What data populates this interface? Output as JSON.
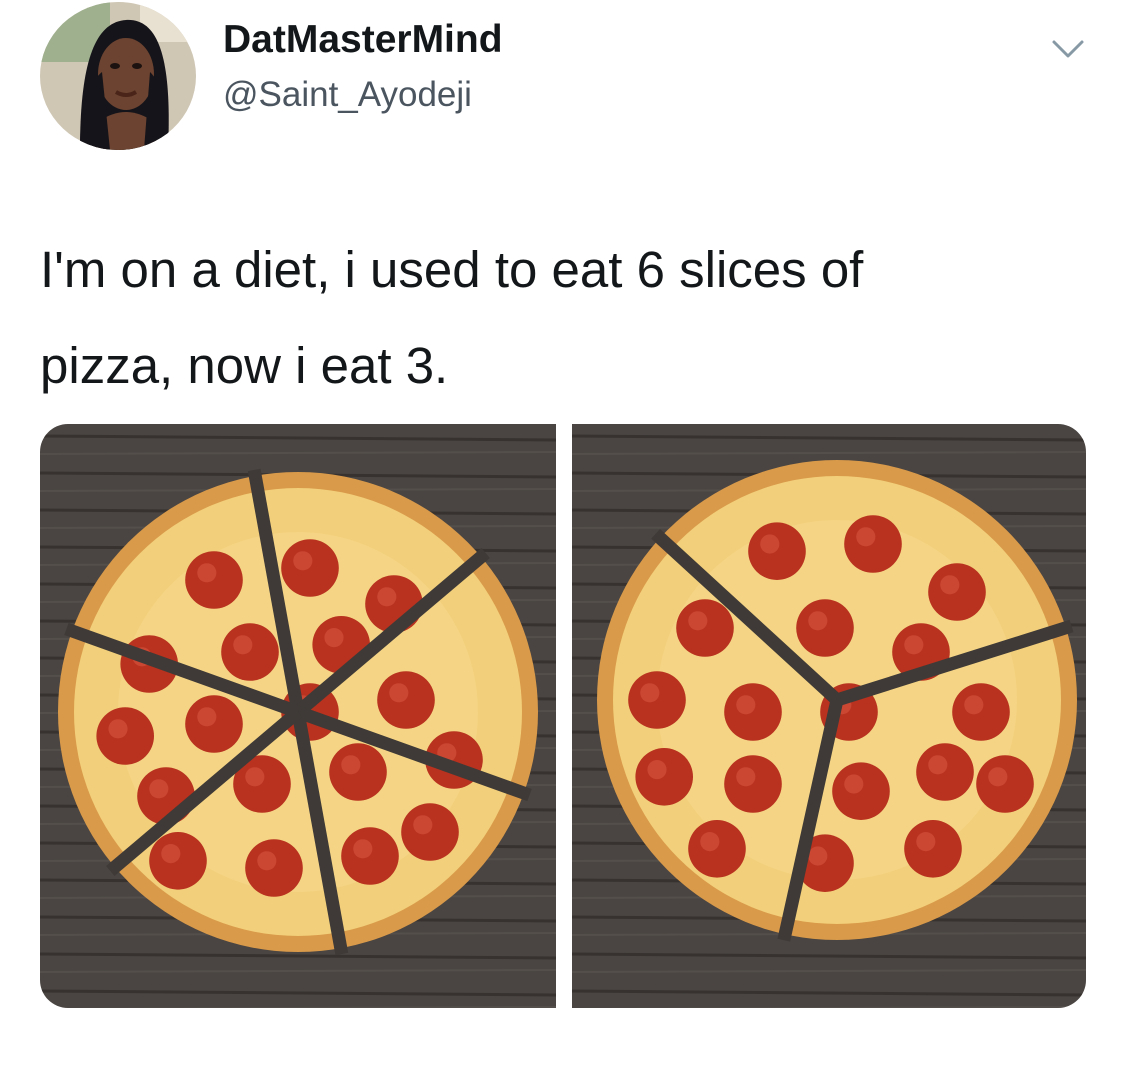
{
  "tweet": {
    "author": {
      "display_name": "DatMasterMind",
      "handle": "@Saint_Ayodeji"
    },
    "text": "I'm on a diet, i used to eat 6 slices of\npizza, now i eat 3."
  },
  "media": {
    "panels": [
      {
        "slices": 6,
        "description_icon": "pizza-6-slices"
      },
      {
        "slices": 3,
        "description_icon": "pizza-3-slices"
      }
    ]
  },
  "icons": {
    "more": "chevron-down-icon"
  },
  "colors": {
    "text_primary": "#14171a",
    "text_secondary": "#4a5560",
    "icon_gray": "#8899a6",
    "wood": "#4a4542",
    "crust": "#d99a4a",
    "cheese": "#f2cf7a",
    "pepperoni": "#b8321f"
  }
}
